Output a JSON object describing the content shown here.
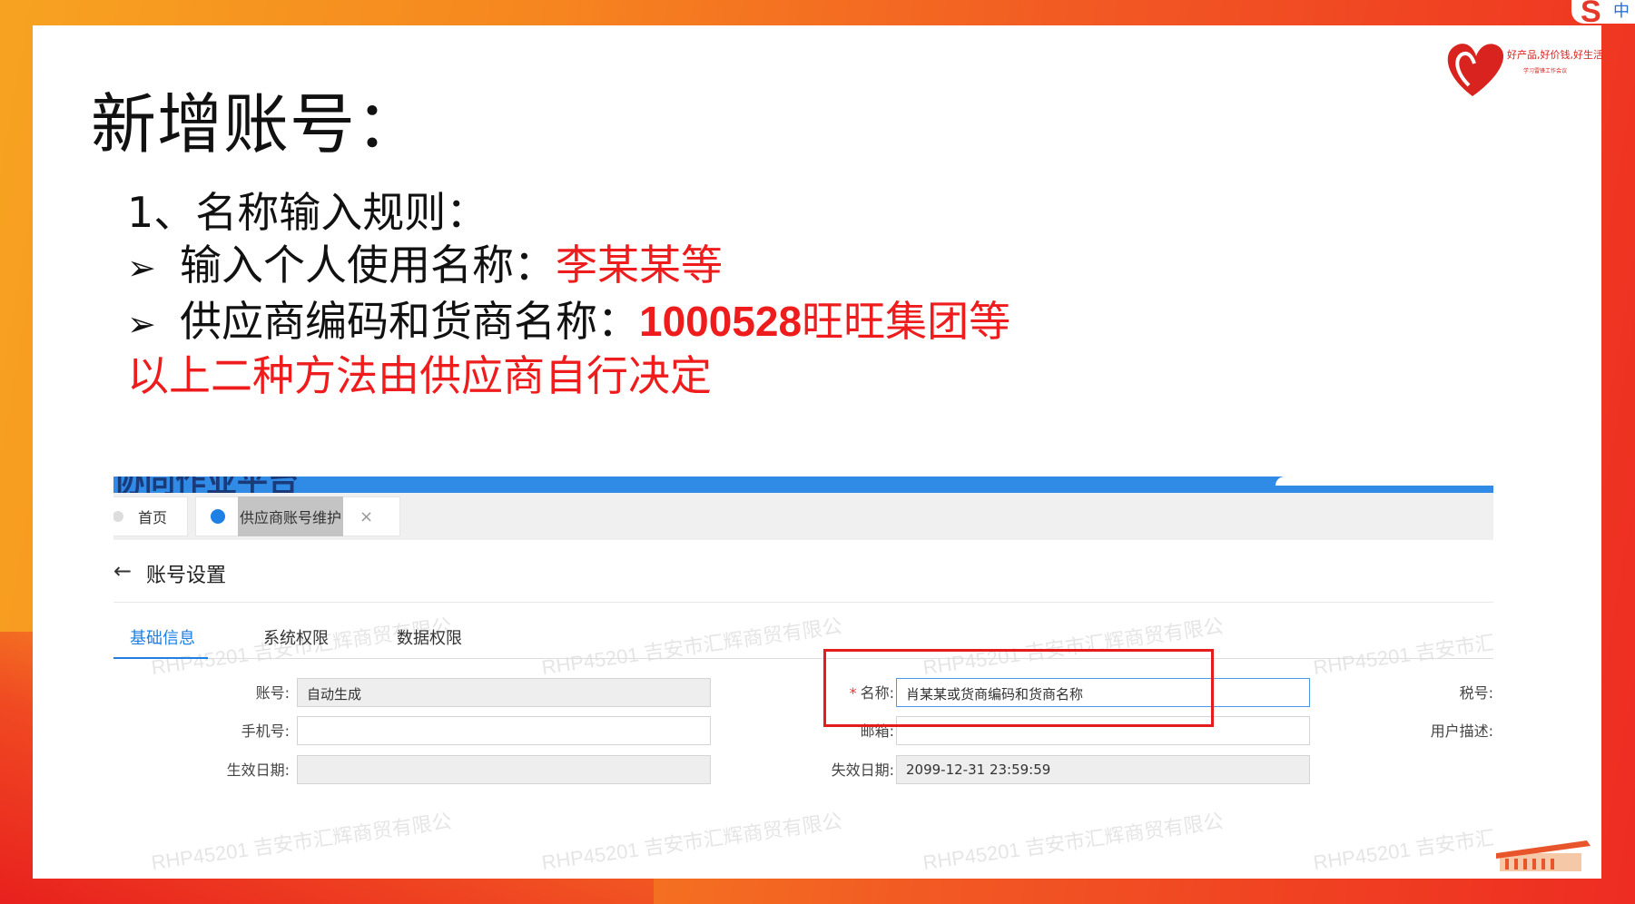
{
  "slide": {
    "title": "新增账号：",
    "rule_heading": "1、名称输入规则：",
    "bullet1_prefix": "输入个人使用名称：",
    "bullet1_value": "李某某等",
    "bullet2_prefix": "供应商编码和货商名称：",
    "bullet2_code": "1000528",
    "bullet2_name": "旺旺集团等",
    "note": "以上二种方法由供应商自行决定",
    "bullet_glyph": "➢",
    "corner_badge_letter": "S",
    "corner_badge_text": "中"
  },
  "logo": {
    "slogan": "好产品,好价钱,好生活",
    "sub": "学习雷锋工作会议"
  },
  "app": {
    "header_title": "协同作业平台",
    "tabs": [
      {
        "label": "首页"
      },
      {
        "label": "供应商账号维护",
        "close": "×"
      }
    ],
    "back_arrow": "←",
    "page_title": "账号设置",
    "subtabs": [
      "基础信息",
      "系统权限",
      "数据权限"
    ],
    "form": {
      "account_label": "账号:",
      "account_value": "自动生成",
      "name_label": "名称:",
      "name_value": "肖某某或货商编码和货商名称",
      "tax_label": "税号:",
      "phone_label": "手机号:",
      "phone_value": "",
      "email_label": "邮箱:",
      "email_value": "",
      "user_desc_label": "用户描述:",
      "effective_label": "生效日期:",
      "effective_value": "",
      "expire_label": "失效日期:",
      "expire_value": "2099-12-31 23:59:59"
    },
    "watermark": "RHP45201 吉安市汇辉商贸有限公"
  },
  "colors": {
    "accent_blue": "#1e7fe4",
    "highlight_red": "#ee1c1c",
    "bg_orange": "#f6861f"
  }
}
